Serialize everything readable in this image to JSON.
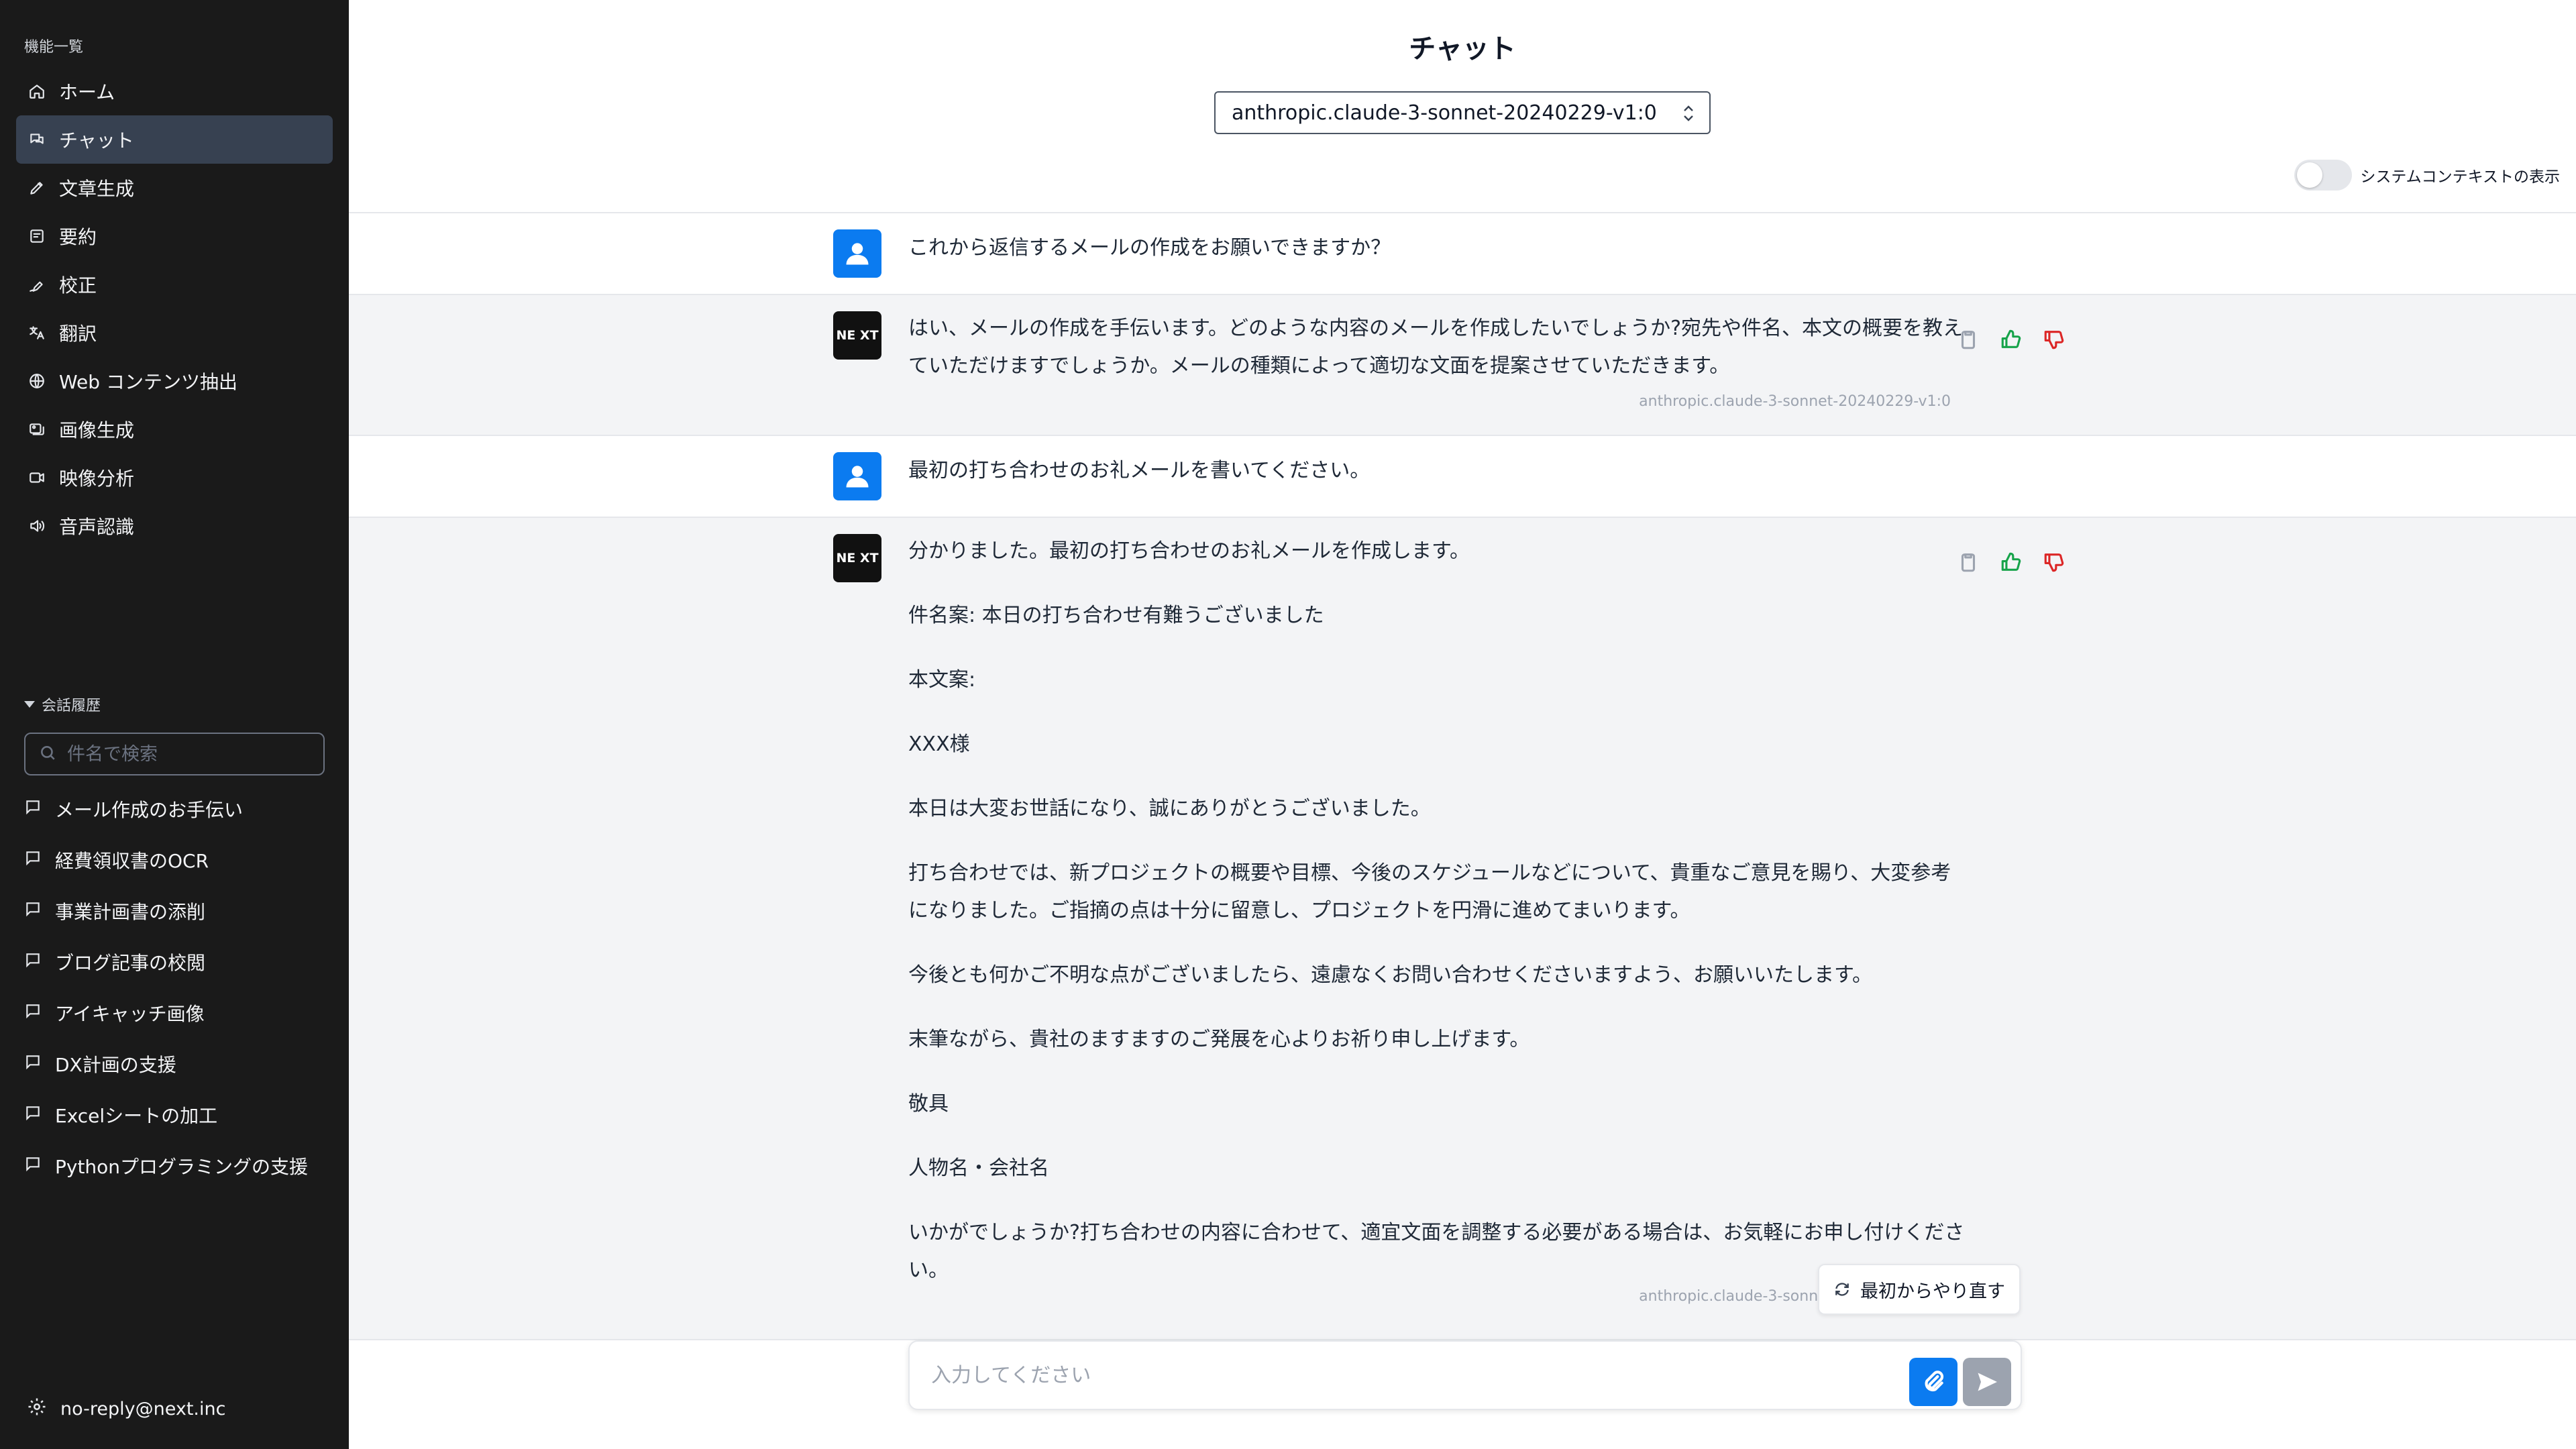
{
  "sidebar": {
    "section_title": "機能一覧",
    "nav": [
      {
        "label": "ホーム",
        "icon": "home-icon"
      },
      {
        "label": "チャット",
        "icon": "chat-icon",
        "active": true
      },
      {
        "label": "文章生成",
        "icon": "pencil-icon"
      },
      {
        "label": "要約",
        "icon": "document-icon"
      },
      {
        "label": "校正",
        "icon": "pen-icon"
      },
      {
        "label": "翻訳",
        "icon": "translate-icon"
      },
      {
        "label": "Web コンテンツ抽出",
        "icon": "globe-icon"
      },
      {
        "label": "画像生成",
        "icon": "image-icon"
      },
      {
        "label": "映像分析",
        "icon": "video-icon"
      },
      {
        "label": "音声認識",
        "icon": "speaker-icon"
      }
    ],
    "history_title": "会話履歴",
    "search_placeholder": "件名で検索",
    "history": [
      "メール作成のお手伝い",
      "経費領収書のOCR",
      "事業計画書の添削",
      "ブログ記事の校閲",
      "アイキャッチ画像",
      "DX計画の支援",
      "Excelシートの加工",
      "Pythonプログラミングの支援"
    ],
    "footer_user": "no-reply@next.inc"
  },
  "main": {
    "title": "チャット",
    "model": "anthropic.claude-3-sonnet-20240229-v1:0",
    "system_context_label": "システムコンテキストの表示",
    "system_context_on": false,
    "messages": [
      {
        "role": "user",
        "text": "これから返信するメールの作成をお願いできますか？"
      },
      {
        "role": "assistant",
        "avatar_text": "NE XT",
        "paragraphs": [
          "はい、メールの作成を手伝います。どのような内容のメールを作成したいでしょうか?宛先や件名、本文の概要を教えていただけますでしょうか。メールの種類によって適切な文面を提案させていただきます。"
        ],
        "model_tag": "anthropic.claude-3-sonnet-20240229-v1:0"
      },
      {
        "role": "user",
        "text": "最初の打ち合わせのお礼メールを書いてください。"
      },
      {
        "role": "assistant",
        "avatar_text": "NE XT",
        "paragraphs": [
          "分かりました。最初の打ち合わせのお礼メールを作成します。",
          "件名案: 本日の打ち合わせ有難うございました",
          "本文案:",
          "XXX様",
          "本日は大変お世話になり、誠にありがとうございました。",
          "打ち合わせでは、新プロジェクトの概要や目標、今後のスケジュールなどについて、貴重なご意見を賜り、大変参考になりました。ご指摘の点は十分に留意し、プロジェクトを円滑に進めてまいります。",
          "今後とも何かご不明な点がございましたら、遠慮なくお問い合わせくださいますよう、お願いいたします。",
          "末筆ながら、貴社のますますのご発展を心よりお祈り申し上げます。",
          "敬具",
          "人物名・会社名",
          "いかがでしょうか?打ち合わせの内容に合わせて、適宜文面を調整する必要がある場合は、お気軽にお申し付けください。"
        ],
        "model_tag": "anthropic.claude-3-sonnet-20240229-v1:0"
      }
    ],
    "retry_label": "最初からやり直す",
    "input_placeholder": "入力してください"
  },
  "colors": {
    "sidebar_bg": "#1a1a1a",
    "accent": "#0b7bf0",
    "like": "#16a34a",
    "dislike": "#dc2626"
  }
}
